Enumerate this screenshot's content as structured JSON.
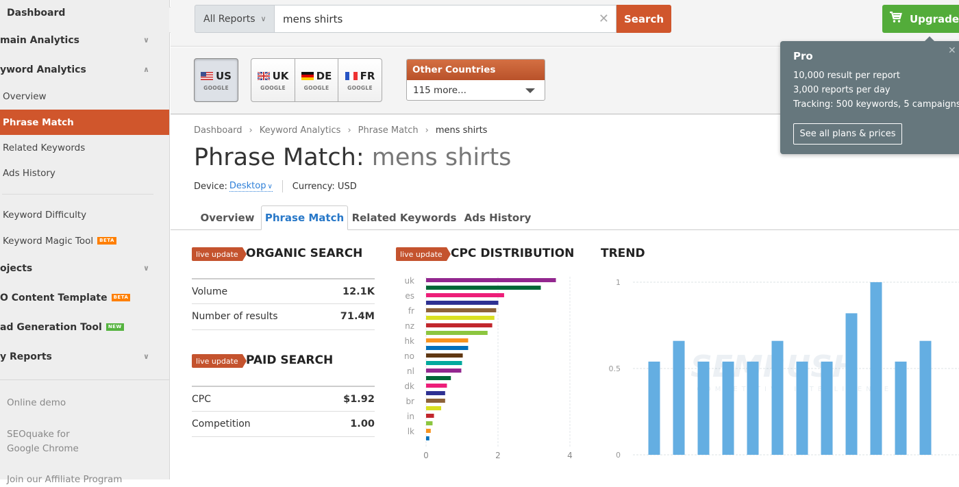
{
  "sidebar": {
    "items": [
      {
        "label": "Dashboard",
        "type": "bold"
      },
      {
        "label": "main Analytics",
        "type": "bold",
        "chevron": "chevron-down-icon"
      },
      {
        "label": "yword Analytics",
        "type": "bold",
        "chevron": "chevron-up-icon"
      },
      {
        "label": "Overview",
        "type": "sub"
      },
      {
        "label": "Phrase Match",
        "type": "sub-active"
      },
      {
        "label": "Related Keywords",
        "type": "sub"
      },
      {
        "label": "Ads History",
        "type": "sub"
      },
      {
        "label": "Keyword Difficulty",
        "type": "sub"
      },
      {
        "label": "Keyword Magic Tool",
        "type": "sub",
        "badge": "BETA"
      },
      {
        "label": "ojects",
        "type": "bold",
        "chevron": "chevron-down-icon"
      },
      {
        "label": "O Content Template",
        "type": "bold",
        "badge": "BETA"
      },
      {
        "label": "ad Generation Tool",
        "type": "bold",
        "badge": "NEW"
      },
      {
        "label": "y Reports",
        "type": "bold",
        "chevron": "chevron-down-icon"
      }
    ],
    "footer": {
      "online_demo": "Online demo",
      "seoquake_line1": "SEOquake for",
      "seoquake_line2": "Google Chrome",
      "affiliate": "Join our Affiliate Program"
    },
    "collapse_icon": "caret-left-icon"
  },
  "search": {
    "database_label": "All Reports",
    "query": "mens shirts",
    "button_label": "Search"
  },
  "upgrade": {
    "label": "Upgrade",
    "icon": "cart-icon"
  },
  "popover": {
    "title": "Pro",
    "lines": [
      "10,000 result per report",
      "3,000 reports per day",
      "Tracking: 500 keywords, 5 campaigns"
    ],
    "button_label": "See all plans & prices"
  },
  "countries": {
    "selected": {
      "code": "US",
      "engine": "GOOGLE"
    },
    "others": [
      {
        "code": "UK",
        "engine": "GOOGLE"
      },
      {
        "code": "DE",
        "engine": "GOOGLE"
      },
      {
        "code": "FR",
        "engine": "GOOGLE"
      }
    ],
    "other_countries": {
      "title": "Other Countries",
      "selected": "115 more..."
    }
  },
  "breadcrumb": [
    "Dashboard",
    "Keyword Analytics",
    "Phrase Match",
    "mens shirts"
  ],
  "page": {
    "title_prefix": "Phrase Match:",
    "title_keyword": "mens shirts",
    "device_label": "Device:",
    "device_value": "Desktop",
    "currency_label": "Currency: USD"
  },
  "tabs": [
    {
      "label": "Overview",
      "active": false
    },
    {
      "label": "Phrase Match",
      "active": true
    },
    {
      "label": "Related Keywords",
      "active": false
    },
    {
      "label": "Ads History",
      "active": false
    }
  ],
  "organic": {
    "badge": "live update",
    "title": "ORGANIC SEARCH",
    "rows": [
      {
        "label": "Volume",
        "value": "12.1K"
      },
      {
        "label": "Number of results",
        "value": "71.4M"
      }
    ]
  },
  "paid": {
    "badge": "live update",
    "title": "PAID SEARCH",
    "rows": [
      {
        "label": "CPC",
        "value": "$1.92"
      },
      {
        "label": "Competition",
        "value": "1.00"
      }
    ]
  },
  "chart_data": [
    {
      "type": "bar",
      "orientation": "horizontal",
      "badge": "live update",
      "title": "CPC DISTRIBUTION",
      "categories": [
        "uk",
        "",
        "es",
        "",
        "fr",
        "",
        "nz",
        "",
        "hk",
        "",
        "no",
        "",
        "nl",
        "",
        "dk",
        "",
        "br",
        "",
        "in",
        "",
        "lk",
        ""
      ],
      "values": [
        3.61,
        3.19,
        2.17,
        2.01,
        1.95,
        1.9,
        1.84,
        1.71,
        1.17,
        1.17,
        1.02,
        1.0,
        0.98,
        0.69,
        0.58,
        0.53,
        0.53,
        0.42,
        0.22,
        0.18,
        0.13,
        0.09
      ],
      "colors": [
        "#93278f",
        "#006837",
        "#ed1e79",
        "#2e3192",
        "#8c6239",
        "#d9e021",
        "#c1272d",
        "#8cc63f",
        "#f7931e",
        "#0071bc",
        "#603813",
        "#00a99d",
        "#93278f",
        "#006837",
        "#ed1e79",
        "#2e3192",
        "#8c6239",
        "#d9e021",
        "#c1272d",
        "#8cc63f",
        "#f7931e",
        "#0071bc"
      ],
      "xticks": [
        "0",
        "2",
        "4"
      ],
      "xlim": [
        0,
        4
      ],
      "grid": true
    },
    {
      "type": "bar",
      "title": "TREND",
      "values": [
        0.54,
        0.66,
        0.54,
        0.54,
        0.54,
        0.66,
        0.54,
        0.54,
        0.82,
        1.0,
        0.54,
        0.66
      ],
      "color": "#64aee2",
      "yticks": [
        "0",
        "0.5",
        "1"
      ],
      "ylim": [
        0,
        1
      ],
      "grid": true,
      "watermark": "SEMRUSH",
      "watermark_sub": "COMPETITIVE INTELLIGENCE"
    }
  ]
}
